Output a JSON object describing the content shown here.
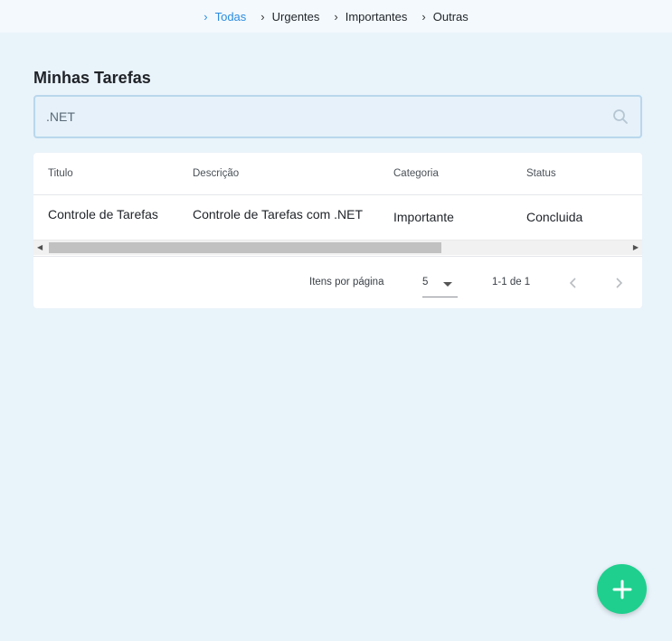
{
  "nav": {
    "items": [
      {
        "label": "Todas",
        "active": true
      },
      {
        "label": "Urgentes",
        "active": false
      },
      {
        "label": "Importantes",
        "active": false
      },
      {
        "label": "Outras",
        "active": false
      }
    ]
  },
  "page": {
    "title": "Minhas Tarefas"
  },
  "search": {
    "value": ".NET",
    "icon": "search-icon"
  },
  "table": {
    "headers": [
      "Titulo",
      "Descrição",
      "Categoria",
      "Status"
    ],
    "rows": [
      [
        "Controle de Tarefas",
        "Controle de Tarefas com .NET",
        "Importante",
        "Concluida"
      ]
    ]
  },
  "paginator": {
    "items_per_page_label": "Itens por página",
    "page_size": "5",
    "range_label": "1-1 de 1"
  },
  "fab": {
    "icon": "plus-icon"
  },
  "colors": {
    "accent": "#2d8cdf",
    "fab": "#1fcf8e",
    "background": "#e9f3fa"
  }
}
